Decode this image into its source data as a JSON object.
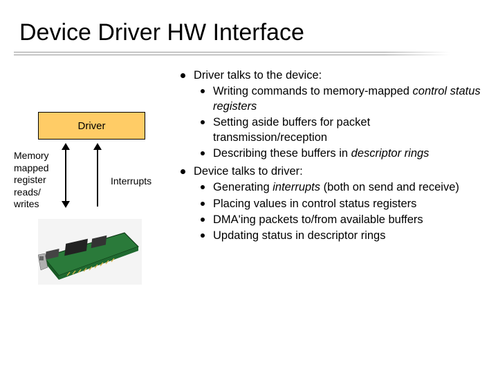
{
  "title": "Device Driver HW Interface",
  "diagram": {
    "driver_box": "Driver",
    "mm_label": "Memory mapped register reads/ writes",
    "interrupts_label": "Interrupts"
  },
  "bullets": {
    "b1": "Driver talks to the device:",
    "b1a_pre": "Writing commands to memory-mapped ",
    "b1a_it": "control status registers",
    "b1b": "Setting aside buffers for packet transmission/reception",
    "b1c_pre": "Describing these buffers in ",
    "b1c_it": "descriptor rings",
    "b2": "Device talks to driver:",
    "b2a_pre": "Generating ",
    "b2a_it": "interrupts",
    "b2a_post": " (both on send and receive)",
    "b2b": "Placing values in control status registers",
    "b2c": "DMA'ing packets to/from available buffers",
    "b2d": "Updating status in descriptor rings"
  }
}
